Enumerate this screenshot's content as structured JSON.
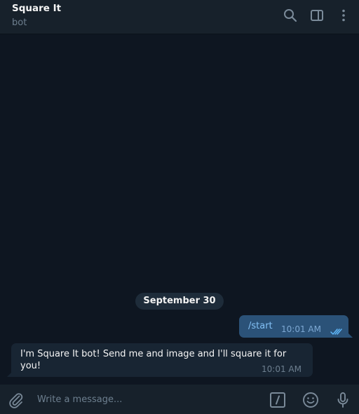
{
  "header": {
    "title": "Square It",
    "subtitle": "bot",
    "icons": [
      "search-icon",
      "sidebar-toggle-icon",
      "more-vertical-icon"
    ]
  },
  "chat": {
    "date_separator": "September 30",
    "messages": [
      {
        "direction": "outgoing",
        "text": "/start",
        "time": "10:01 AM",
        "status": "read"
      },
      {
        "direction": "incoming",
        "text": "I'm Square It bot! Send me and image and I'll square it for you!",
        "time": "10:01 AM"
      }
    ]
  },
  "composer": {
    "placeholder": "Write a message...",
    "icons": [
      "attach-icon",
      "bot-commands-icon",
      "emoji-icon",
      "microphone-icon"
    ]
  },
  "colors": {
    "background": "#0e1621",
    "header": "#17212b",
    "outgoing_bubble": "#2b5278",
    "incoming_bubble": "#182533",
    "accent": "#5eb5f7"
  }
}
